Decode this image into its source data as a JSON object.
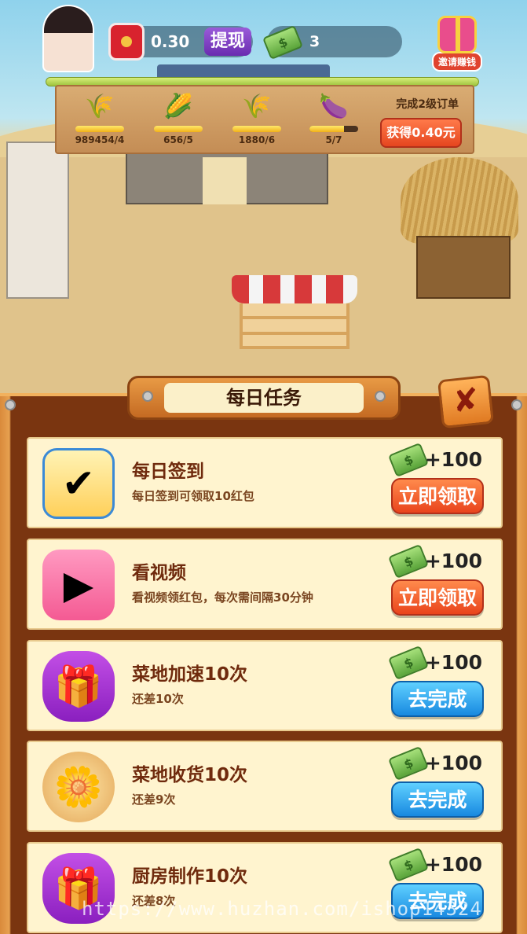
{
  "hud": {
    "cash": "0.30",
    "withdraw_label": "提现",
    "coins": "3",
    "invite_label": "邀请赚钱",
    "money_icon": "money-icon"
  },
  "scene": {
    "crops": [
      {
        "name": "wheat",
        "icon": "wheat-icon",
        "count": "989454/4",
        "progress": 1.0
      },
      {
        "name": "corn",
        "icon": "corn-icon",
        "count": "656/5",
        "progress": 1.0
      },
      {
        "name": "grain",
        "icon": "grain-icon",
        "count": "1880/6",
        "progress": 1.0
      },
      {
        "name": "eggplant",
        "icon": "eggplant-icon",
        "count": "5/7",
        "progress": 0.71
      }
    ],
    "order_title": "完成2级订单",
    "order_button": "获得0.40元"
  },
  "panel": {
    "title": "每日任务",
    "close_symbol": "✘",
    "tasks": [
      {
        "title": "每日签到",
        "desc": "每日签到可领取10红包",
        "reward": "+100",
        "button": "立即领取",
        "type": "claim",
        "icon": "calendar-icon"
      },
      {
        "title": "看视频",
        "desc": "看视频领红包，每次需间隔30分钟",
        "reward": "+100",
        "button": "立即领取",
        "type": "claim",
        "icon": "tv-icon"
      },
      {
        "title": "菜地加速10次",
        "desc": "还差10次",
        "reward": "+100",
        "button": "去完成",
        "type": "go",
        "icon": "gift-box-icon"
      },
      {
        "title": "菜地收货10次",
        "desc": "还差9次",
        "reward": "+100",
        "button": "去完成",
        "type": "go",
        "icon": "flower-basket-icon"
      },
      {
        "title": "厨房制作10次",
        "desc": "还差8次",
        "reward": "+100",
        "button": "去完成",
        "type": "go",
        "icon": "gift-box-icon"
      }
    ]
  },
  "watermark": "https://www.huzhan.com/ishop14324",
  "colors": {
    "claim": "#e9441c",
    "go": "#1889e0",
    "panel_wood": "#7a3510"
  }
}
